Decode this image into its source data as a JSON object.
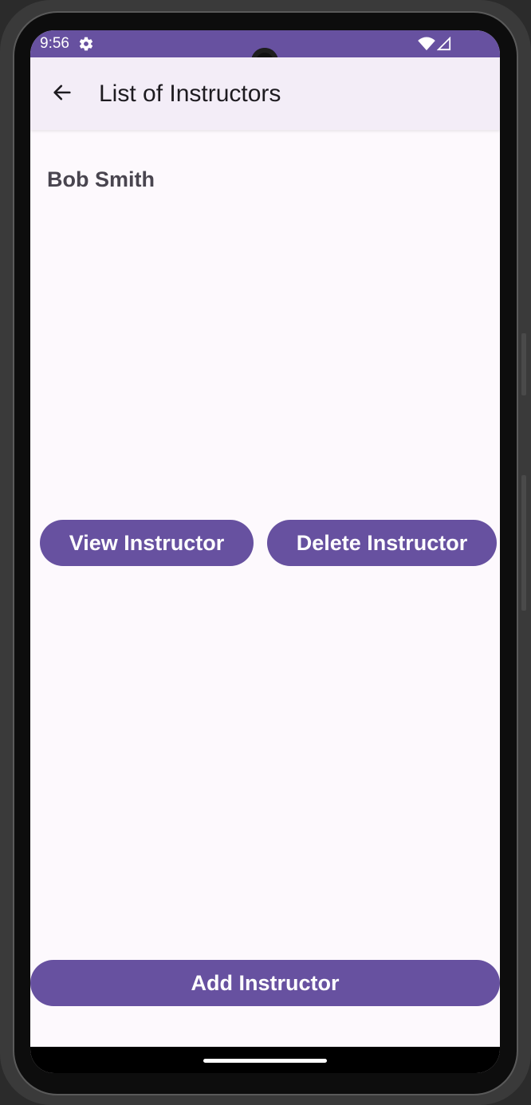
{
  "status_bar": {
    "time": "9:56",
    "icons": [
      "gear-icon",
      "wifi-icon",
      "cell-signal-icon"
    ]
  },
  "app_bar": {
    "title": "List of Instructors",
    "back_icon": "arrow-left-icon"
  },
  "instructors": [
    {
      "name": "Bob Smith"
    }
  ],
  "actions": {
    "view_label": "View Instructor",
    "delete_label": "Delete Instructor",
    "add_label": "Add Instructor"
  },
  "colors": {
    "primary": "#6751a0",
    "app_bar_bg": "#f3edf7",
    "screen_bg": "#fdf9fd",
    "name_text": "#49454f"
  }
}
